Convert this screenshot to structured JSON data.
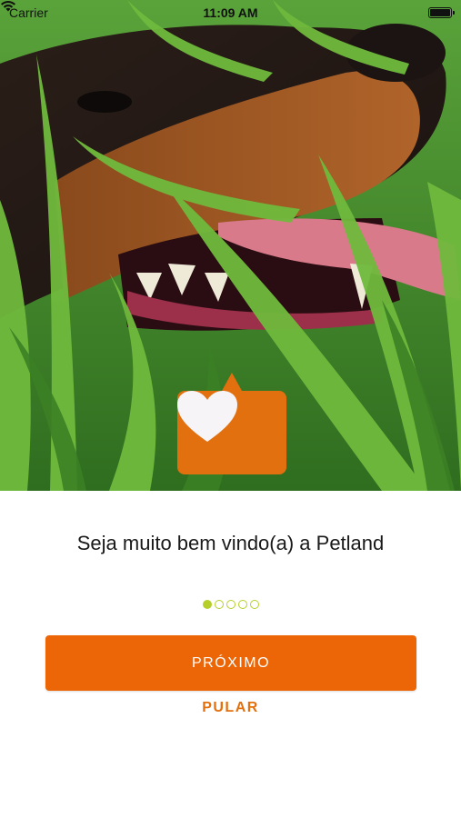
{
  "status_bar": {
    "carrier": "Carrier",
    "time": "11:09 AM"
  },
  "hero": {
    "image": "dog-in-grass-photo"
  },
  "badge": {
    "icon": "heart-icon",
    "color": "#e2700e"
  },
  "onboarding": {
    "title": "Seja muito bem vindo(a) a Petland",
    "page_indicator": {
      "total": 5,
      "current": 1,
      "color": "#b7cf2a"
    },
    "next_label": "PRÓXIMO",
    "skip_label": "PULAR"
  },
  "colors": {
    "primary": "#ec6608",
    "accent": "#e2700e",
    "indicator": "#b7cf2a"
  }
}
